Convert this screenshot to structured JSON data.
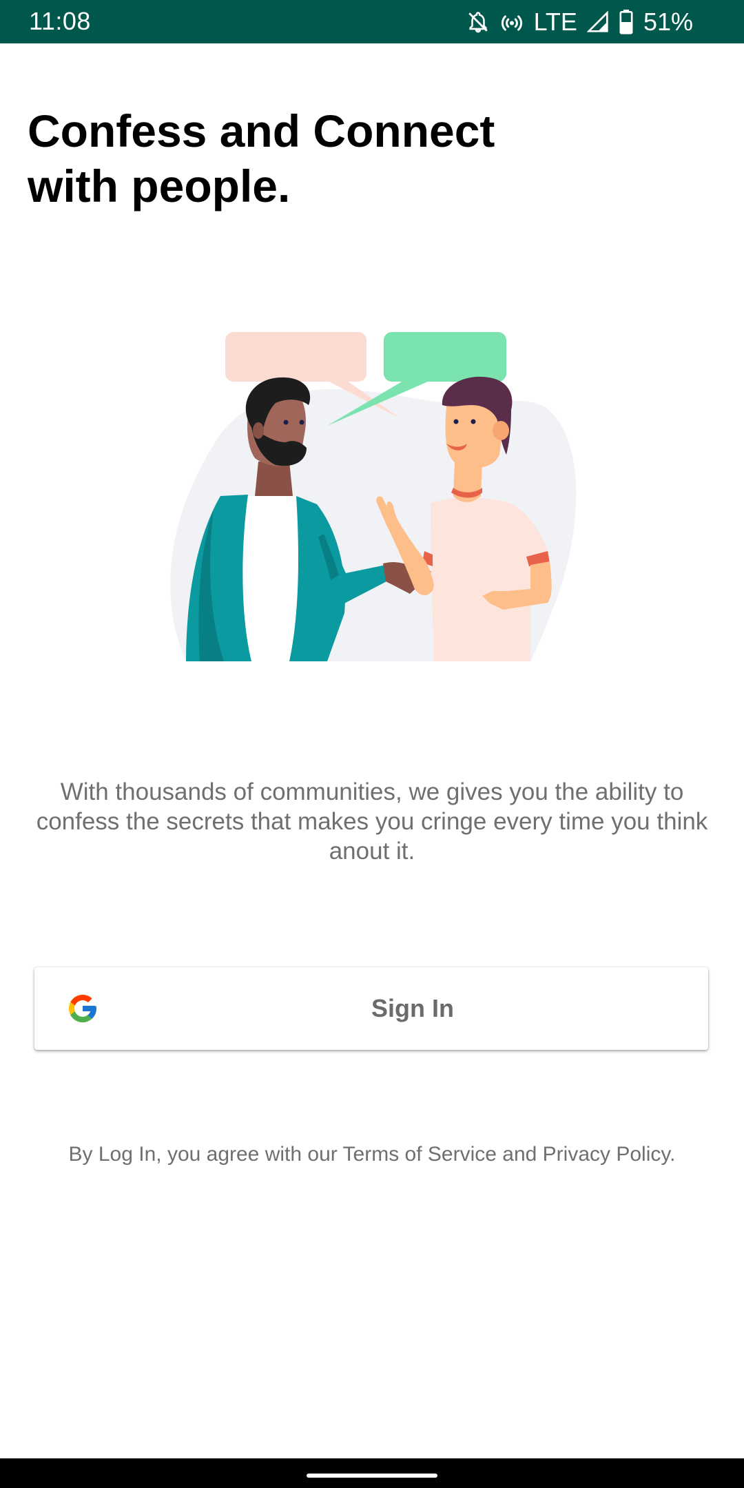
{
  "status_bar": {
    "time": "11:08",
    "network": "LTE",
    "battery": "51%",
    "battery_level": 0.51,
    "icons": [
      "notifications-off-icon",
      "hotspot-icon",
      "signal-icon",
      "battery-icon"
    ],
    "background_color": "#00574b"
  },
  "headline": {
    "line1": "Confess and Connect",
    "line2": "with people."
  },
  "illustration": {
    "name": "two-people-chatting-illustration",
    "colors": {
      "left_bubble": "#fcdcd2",
      "right_bubble": "#7be3ad",
      "jacket": "#0b9aa0",
      "skin_dark": "#a0665a",
      "skin_light": "#fdbe8a",
      "hair": "#5a2d4a",
      "shirt": "#fde4dc",
      "background_blob": "#f1f2f6"
    }
  },
  "description": "With thousands of communities, we gives you the ability to confess the secrets that makes you cringe every time you think anout it.",
  "signin_button": {
    "label": "Sign In",
    "icon": "google-icon"
  },
  "legal_text": "By Log In, you agree with our Terms of Service and Privacy Policy."
}
